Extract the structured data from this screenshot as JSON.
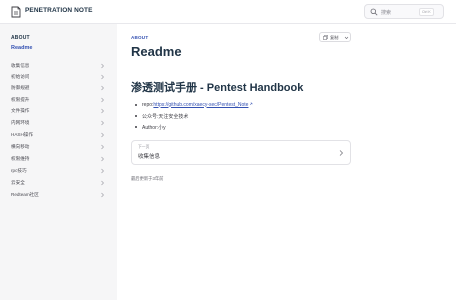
{
  "nav": {
    "site_title": "PENETRATION NOTE",
    "search_placeholder": "搜索",
    "search_shortcut": "Ctrl K"
  },
  "sidebar": {
    "section": "ABOUT",
    "active_item": "Readme",
    "items": [
      {
        "label": "收集信息"
      },
      {
        "label": "初始访问"
      },
      {
        "label": "防御规避"
      },
      {
        "label": "权限提升"
      },
      {
        "label": "文件操作"
      },
      {
        "label": "内网环境"
      },
      {
        "label": "HASH操作"
      },
      {
        "label": "横向移动"
      },
      {
        "label": "权限维持"
      },
      {
        "label": "rpc技巧"
      },
      {
        "label": "云安全"
      },
      {
        "label": "Redteam社区"
      }
    ]
  },
  "main": {
    "breadcrumb": "ABOUT",
    "copy_label": "复制",
    "title": "Readme",
    "heading": "渗透测试手册 - Pentest Handbook",
    "bullets": {
      "repo_prefix": "repo:",
      "repo_link": "https://github.com/xaecy-sec/Pentest_Note",
      "wechat": "公众号:天注安全技术",
      "author": "Author:小y"
    },
    "next": {
      "caption": "下一页",
      "title": "收集信息"
    },
    "last_updated": "最后更新于3年前"
  },
  "icons": {
    "logo": "logo-icon",
    "search": "search-icon",
    "copy": "copy-icon",
    "chevron": "chevron-right-icon",
    "external": "external-link-icon"
  },
  "colors": {
    "accent": "#3451b2",
    "sidebar_bg": "#f6f6f7",
    "text": "#3c3c43"
  }
}
